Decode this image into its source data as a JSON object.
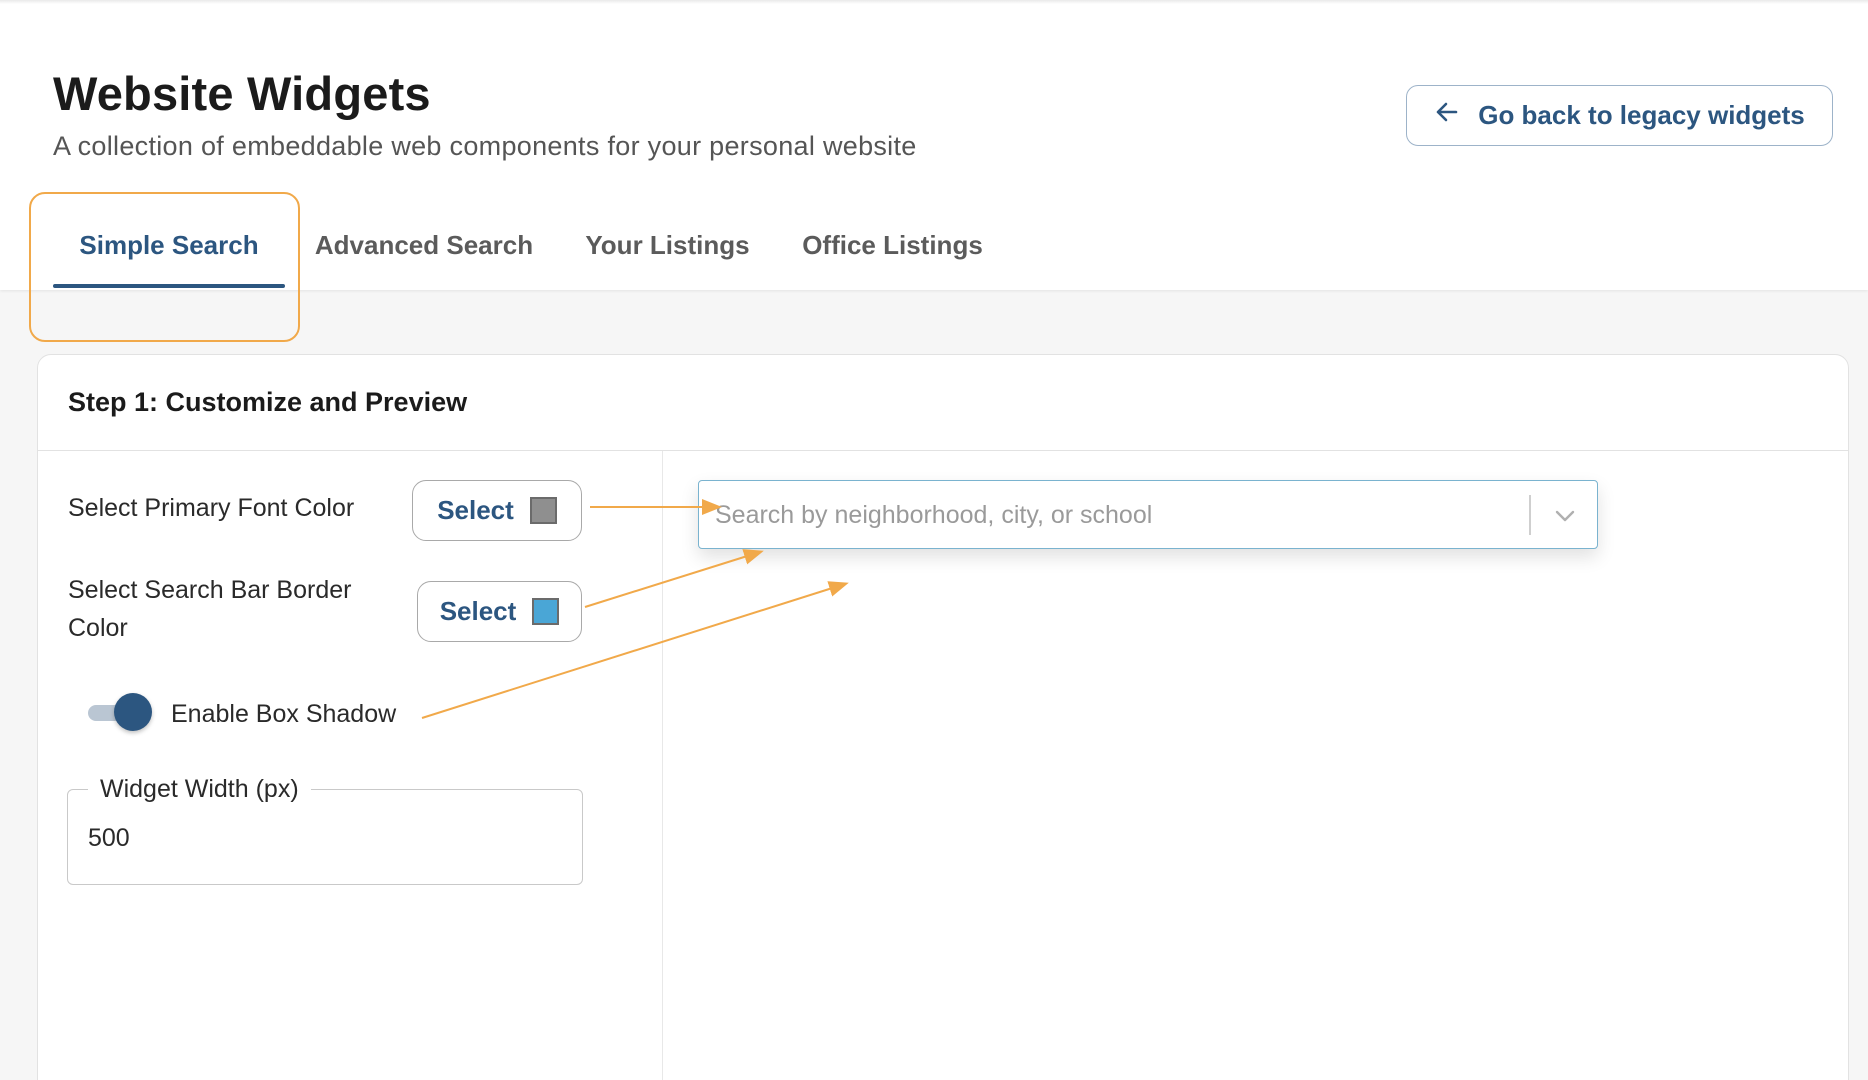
{
  "header": {
    "title": "Website Widgets",
    "subtitle": "A collection of embeddable web components for your personal website",
    "back_button": {
      "label": "Go back to legacy widgets",
      "icon": "arrow-left-icon"
    }
  },
  "tabs": [
    {
      "label": "Simple Search",
      "active": true
    },
    {
      "label": "Advanced Search",
      "active": false
    },
    {
      "label": "Your Listings",
      "active": false
    },
    {
      "label": "Office Listings",
      "active": false
    }
  ],
  "card": {
    "title": "Step 1: Customize and Preview",
    "primary_font_color": {
      "label": "Select Primary Font Color",
      "button_label": "Select",
      "swatch_color": "#8f8f8f"
    },
    "border_color": {
      "label_line1": "Select Search Bar Border",
      "label_line2": "Color",
      "button_label": "Select",
      "swatch_color": "#4aa6d6"
    },
    "box_shadow": {
      "label": "Enable Box Shadow",
      "enabled": true
    },
    "widget_width": {
      "label": "Widget Width (px)",
      "value": "500"
    }
  },
  "preview": {
    "placeholder": "Search by neighborhood, city, or school",
    "icon": "chevron-down-icon"
  },
  "colors": {
    "accent": "#2c5680",
    "annotation": "#f1a94a",
    "preview_border": "#7ab3cf"
  }
}
